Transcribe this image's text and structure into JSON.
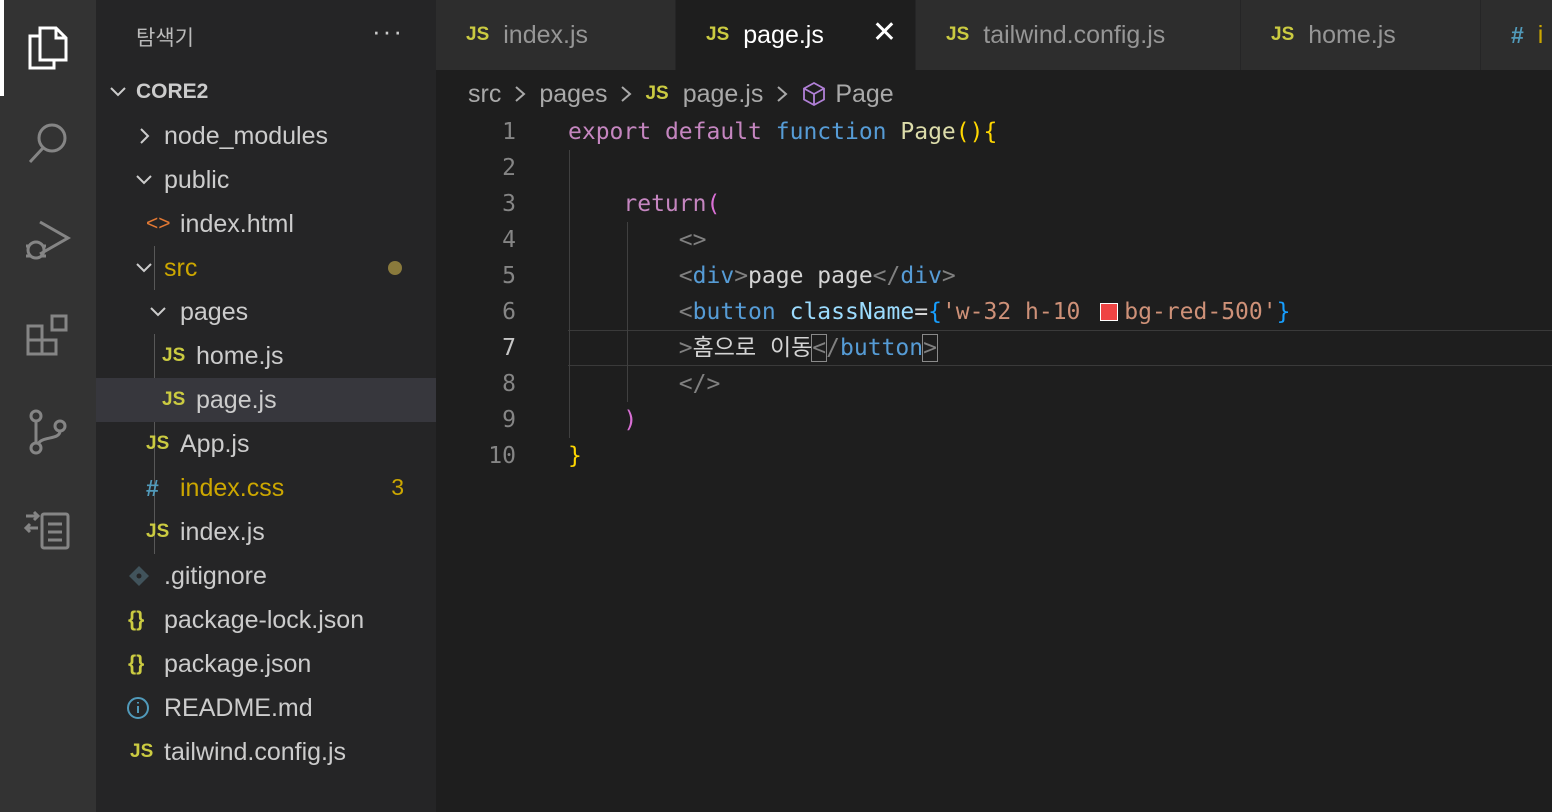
{
  "activity_bar": {
    "icons": [
      "explorer-icon",
      "search-icon",
      "run-debug-icon",
      "extensions-icon",
      "source-control-icon",
      "remote-explorer-icon"
    ]
  },
  "sidebar": {
    "title": "탐색기",
    "more": "···",
    "root": "CORE2",
    "items": [
      {
        "label": "node_modules",
        "icon": "chevron-right"
      },
      {
        "label": "public",
        "icon": "chevron-down"
      },
      {
        "label": "index.html",
        "icon": "html-file-icon",
        "glyph": "<>"
      },
      {
        "label": "src",
        "icon": "chevron-down"
      },
      {
        "label": "pages",
        "icon": "chevron-down"
      },
      {
        "label": "home.js",
        "icon": "js-file-icon",
        "glyph": "JS"
      },
      {
        "label": "page.js",
        "icon": "js-file-icon",
        "glyph": "JS"
      },
      {
        "label": "App.js",
        "icon": "js-file-icon",
        "glyph": "JS"
      },
      {
        "label": "index.css",
        "icon": "css-file-icon",
        "glyph": "#",
        "badge": "3"
      },
      {
        "label": "index.js",
        "icon": "js-file-icon",
        "glyph": "JS"
      },
      {
        "label": ".gitignore",
        "icon": "git-file-icon"
      },
      {
        "label": "package-lock.json",
        "icon": "json-file-icon",
        "glyph": "{}"
      },
      {
        "label": "package.json",
        "icon": "json-file-icon",
        "glyph": "{}"
      },
      {
        "label": "README.md",
        "icon": "info-file-icon"
      },
      {
        "label": "tailwind.config.js",
        "icon": "js-file-icon",
        "glyph": "JS"
      }
    ]
  },
  "tabs": [
    {
      "label": "index.js",
      "glyph": "JS"
    },
    {
      "label": "page.js",
      "glyph": "JS",
      "active": true,
      "close": "✕"
    },
    {
      "label": "tailwind.config.js",
      "glyph": "JS"
    },
    {
      "label": "home.js",
      "glyph": "JS"
    },
    {
      "label": "i",
      "glyph": "#"
    }
  ],
  "breadcrumb": {
    "parts": [
      "src",
      "pages",
      "page.js",
      "Page"
    ],
    "js_glyph": "JS"
  },
  "editor": {
    "line_numbers": [
      "1",
      "2",
      "3",
      "4",
      "5",
      "6",
      "7",
      "8",
      "9",
      "10"
    ],
    "current_line": "7",
    "tokens": {
      "export": "export",
      "default": "default",
      "function": "function",
      "name": "Page",
      "paren_open": "(",
      "paren_close": ")",
      "brace_open": "{",
      "brace_close": "}",
      "return": "return",
      "frag_open": "<>",
      "frag_close": "</>",
      "lt": "<",
      "gt": ">",
      "lt_slash": "</",
      "div": "div",
      "div_text": "page page",
      "button": "button",
      "classname": "className",
      "eq": "=",
      "str_part1": "'w-32 h-10 ",
      "str_part2": "bg-red-500'",
      "button_text": "홈으로 이동"
    },
    "swatch_color": "#ef4444"
  }
}
